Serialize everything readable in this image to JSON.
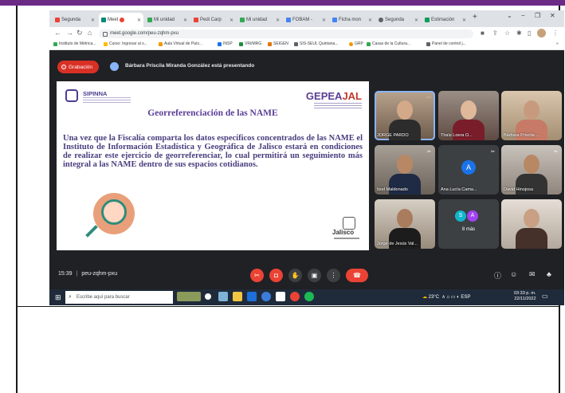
{
  "browser": {
    "tabs": [
      {
        "label": "Segunda",
        "favicon_color": "#ea4335"
      },
      {
        "label": "Meet",
        "favicon_color": "#00897b",
        "recording": true
      },
      {
        "label": "Mi unidad",
        "favicon_color": "#34a853"
      },
      {
        "label": "Pedi Carp",
        "favicon_color": "#ea4335"
      },
      {
        "label": "Mi unidad",
        "favicon_color": "#34a853"
      },
      {
        "label": "FOBAM -",
        "favicon_color": "#4285f4"
      },
      {
        "label": "Ficha mon",
        "favicon_color": "#4285f4"
      },
      {
        "label": "Segunda",
        "favicon_color": "#5f6368"
      },
      {
        "label": "Estimación",
        "favicon_color": "#0f9d58"
      }
    ],
    "new_tab": "+",
    "url": "meet.google.com/peu-zqhm-pxu",
    "bookmarks": [
      "Instituto de Métrica...",
      "Curso: Ingresar al s...",
      "Aula Virtual de País...",
      "INSP",
      "VRi/MRG",
      "SEIGEN",
      "SIS-SEUL Quintana...",
      "GRP",
      "Casas de la Cultura...",
      "Panel de control j..."
    ]
  },
  "meet": {
    "recording_label": "Grabación",
    "presenting_text": "Bárbara Priscila Miranda González está presentando",
    "slide": {
      "logo_left": "SIPINNA",
      "logo_right_pre": "GEPEA",
      "logo_right_accent": "JAL",
      "title": "Georreferenciación de las NAME",
      "body": "Una vez que la Fiscalía comparta los datos específicos concentrados de las NAME el Instituto de Información Estadística y Geográfica de Jalisco estará en condiciones de realizar este ejercicio de georreferenciar, lo cual permitirá un seguimiento más integral a las NAME dentro de sus espacios cotidianos.",
      "footer_logo": "Jalisco"
    },
    "participants": [
      {
        "name": "JORGE PARDO",
        "muted": false
      },
      {
        "name": "Thaïs Loera O...",
        "muted": false
      },
      {
        "name": "Bárbara Priscila ...",
        "muted": false
      },
      {
        "name": "Itzel Maldonado",
        "muted": true
      },
      {
        "name": "Ana Lucía Cama...",
        "muted": true,
        "initial": "A",
        "color": "#1a73e8"
      },
      {
        "name": "David Hinojosa",
        "muted": true
      },
      {
        "name": "Jorge de Jesús Val...",
        "muted": false
      },
      {
        "more": "8 más",
        "initials": [
          "S",
          "A"
        ],
        "colors": [
          "#12b5cb",
          "#a142f4"
        ]
      },
      {
        "name": "",
        "muted": false
      }
    ],
    "meeting_time": "15:39",
    "meeting_code": "peu-zqhm-pxu"
  },
  "taskbar": {
    "search_placeholder": "Escribe aquí para buscar",
    "weather": "23°C",
    "language": "ESP",
    "clock_time": "03:33 p. m.",
    "clock_date": "22/11/2022"
  }
}
